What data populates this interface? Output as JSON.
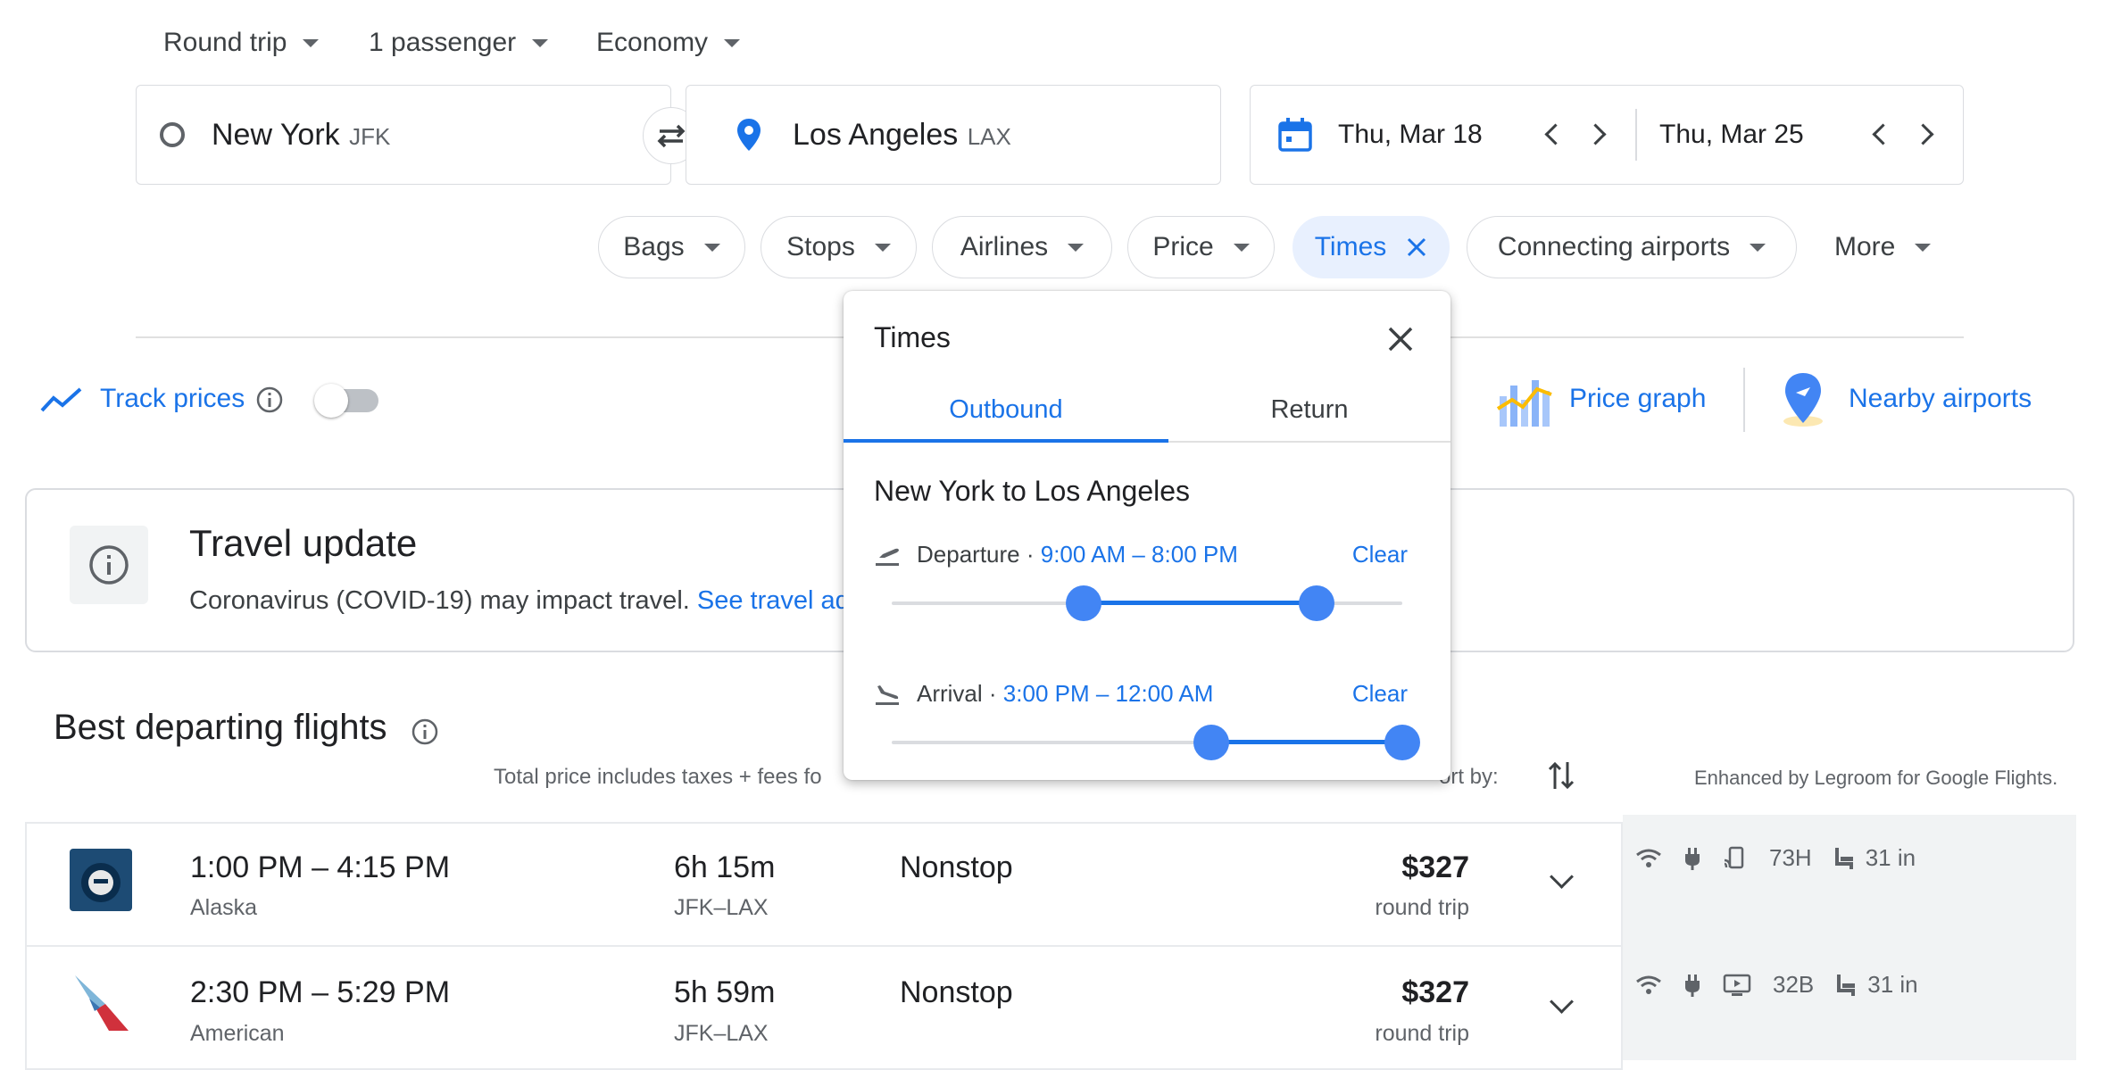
{
  "trip_options": {
    "trip_type": "Round trip",
    "passengers": "1 passenger",
    "cabin_class": "Economy"
  },
  "search": {
    "origin_city": "New York",
    "origin_code": "JFK",
    "destination_city": "Los Angeles",
    "destination_code": "LAX",
    "depart_date": "Thu, Mar 18",
    "return_date": "Thu, Mar 25"
  },
  "filters": {
    "bags": "Bags",
    "stops": "Stops",
    "airlines": "Airlines",
    "price": "Price",
    "times": "Times",
    "connecting_airports": "Connecting airports",
    "more": "More"
  },
  "tools": {
    "track_prices": "Track prices",
    "price_graph": "Price graph",
    "nearby_airports": "Nearby airports"
  },
  "travel_update": {
    "title": "Travel update",
    "text": "Coronavirus (COVID-19) may impact travel.",
    "link": "See travel adv"
  },
  "results": {
    "heading": "Best departing flights",
    "price_note": "Total price includes taxes + fees fo",
    "sort_label": "ort by:",
    "legroom_note": "Enhanced by Legroom for Google Flights."
  },
  "flights": [
    {
      "times": "1:00 PM – 4:15 PM",
      "airline": "Alaska",
      "duration": "6h 15m",
      "route": "JFK–LAX",
      "stops": "Nonstop",
      "price": "$327",
      "price_type": "round trip",
      "aircraft": "73H",
      "legroom": "31 in"
    },
    {
      "times": "2:30 PM – 5:29 PM",
      "airline": "American",
      "duration": "5h 59m",
      "route": "JFK–LAX",
      "stops": "Nonstop",
      "price": "$327",
      "price_type": "round trip",
      "aircraft": "32B",
      "legroom": "31 in"
    }
  ],
  "times_popup": {
    "title": "Times",
    "tab_outbound": "Outbound",
    "tab_return": "Return",
    "route": "New York to Los Angeles",
    "departure_label": "Departure",
    "departure_range": "9:00 AM – 8:00 PM",
    "departure_clear": "Clear",
    "departure_start_fraction": 0.375,
    "departure_end_fraction": 0.833,
    "arrival_label": "Arrival",
    "arrival_range": "3:00 PM – 12:00 AM",
    "arrival_clear": "Clear",
    "arrival_start_fraction": 0.625,
    "arrival_end_fraction": 1.0
  },
  "colors": {
    "accent": "#1a73e8",
    "slider_handle": "#4285f4"
  }
}
